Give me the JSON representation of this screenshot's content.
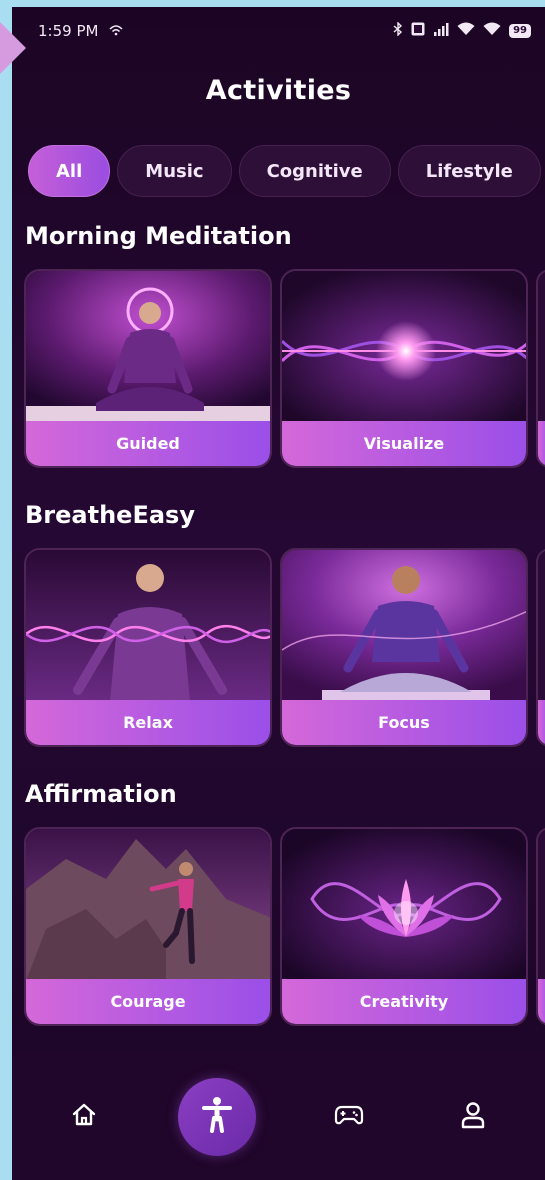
{
  "status_bar": {
    "time": "1:59 PM",
    "battery": "99"
  },
  "header": {
    "title": "Activities"
  },
  "filters": [
    {
      "label": "All",
      "active": true
    },
    {
      "label": "Music",
      "active": false
    },
    {
      "label": "Cognitive",
      "active": false
    },
    {
      "label": "Lifestyle",
      "active": false
    }
  ],
  "sections": [
    {
      "title": "Morning Meditation",
      "cards": [
        "Guided",
        "Visualize"
      ]
    },
    {
      "title": "BreatheEasy",
      "cards": [
        "Relax",
        "Focus"
      ]
    },
    {
      "title": "Affirmation",
      "cards": [
        "Courage",
        "Creativity"
      ]
    }
  ],
  "bottom_nav": {
    "items": [
      "home-icon",
      "accessibility-icon",
      "gamepad-icon",
      "profile-icon"
    ],
    "active": "accessibility-icon"
  },
  "colors": {
    "accent": "#c55fd8",
    "label_gradient_start": "#d468d9",
    "label_gradient_end": "#9a4fe8",
    "background": "#1c0524"
  }
}
